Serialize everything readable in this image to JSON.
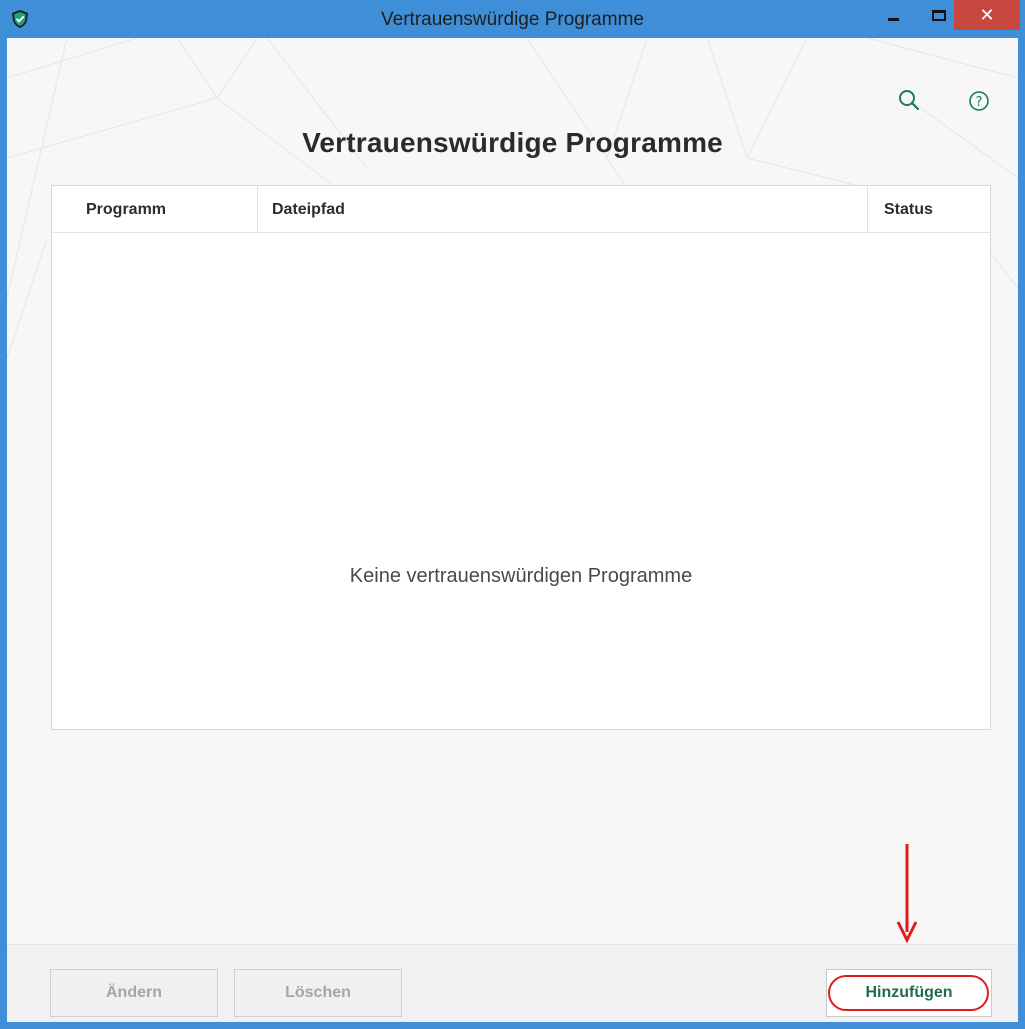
{
  "window": {
    "title": "Vertrauenswürdige Programme",
    "app_icon": "kaspersky-shield-icon",
    "frame_color": "#3f8fd8",
    "close_color": "#c7463e",
    "close_glyph": "✕"
  },
  "toolbar": {
    "search_icon": "search-icon",
    "help_icon": "help-icon"
  },
  "page": {
    "heading": "Vertrauenswürdige Programme"
  },
  "table": {
    "columns": [
      "Programm",
      "Dateipfad",
      "Status"
    ],
    "rows": [],
    "empty_message": "Keine vertrauenswürdigen Programme"
  },
  "footer": {
    "edit_label": "Ändern",
    "delete_label": "Löschen",
    "add_label": "Hinzufügen",
    "accent_color": "#1e6b4f",
    "highlight_color": "#e01d1d"
  }
}
